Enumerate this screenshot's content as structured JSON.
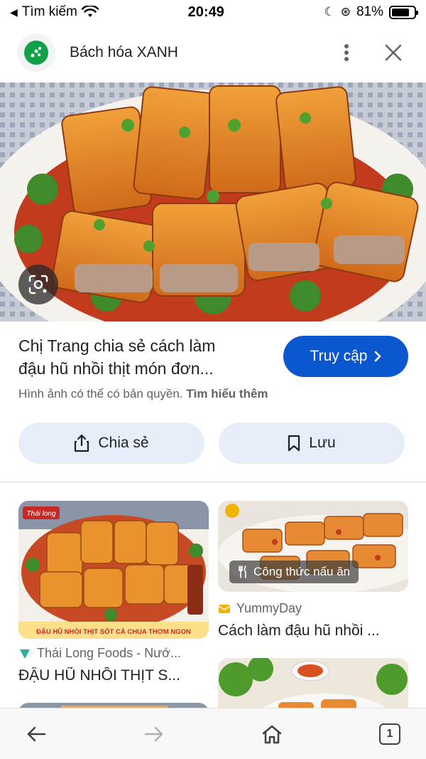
{
  "status_bar": {
    "back_app_label": "Tìm kiếm",
    "time": "20:49",
    "battery_percent": "81%",
    "battery_level": 0.81
  },
  "header": {
    "site_name": "Bách hóa XANH",
    "logo_icon": "bach-hoa-xanh-logo",
    "more_icon": "more-vert-icon",
    "close_icon": "close-icon"
  },
  "result": {
    "title_line1": "Chị Trang chia sẻ cách làm",
    "title_line2": "đậu hũ nhồi thịt món đơn...",
    "visit_label": "Truy cập",
    "copyright_text": "Hình ảnh có thể có bản quyền.",
    "learn_more": "Tìm hiểu thêm",
    "share_label": "Chia sẻ",
    "save_label": "Lưu"
  },
  "related": [
    {
      "source": "Thái Long Foods - Nướ...",
      "title": "ĐẬU HŨ NHỒI THỊT S...",
      "banner_text": "ĐẬU HŨ NHỒI THỊT SỐT CÀ CHUA THƠM NGON",
      "brand_tag": "Thái long"
    },
    {
      "source": "YummyDay",
      "title": "Cách làm đậu hũ nhồi ...",
      "chip_label": "Công thức nấu ăn"
    }
  ],
  "toolbar": {
    "back_icon": "arrow-back-icon",
    "forward_icon": "arrow-forward-icon",
    "home_icon": "home-icon",
    "tab_count": "1"
  },
  "colors": {
    "accent": "#0b57d0",
    "pill_bg": "#e8eef9",
    "logo_green": "#12a14b"
  }
}
